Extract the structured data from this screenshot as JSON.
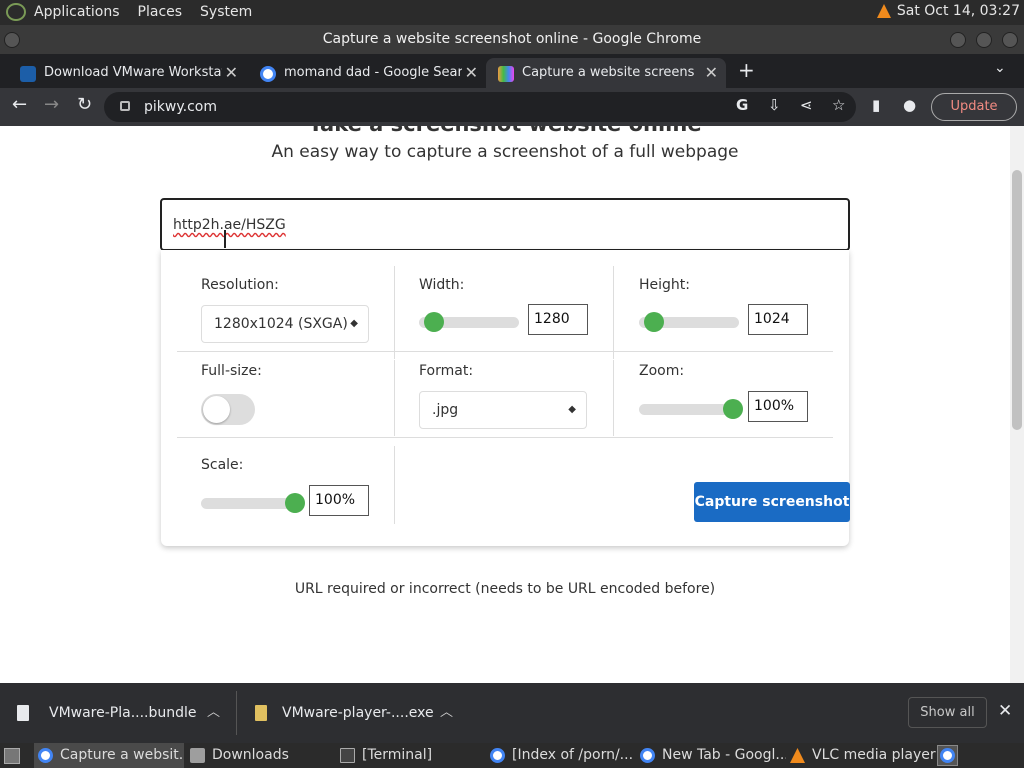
{
  "system_bar": {
    "menus": [
      "Applications",
      "Places",
      "System"
    ],
    "clock": "Sat Oct 14, 03:27"
  },
  "window": {
    "title": "Capture a website screenshot online - Google Chrome"
  },
  "tabs": [
    {
      "label": "Download VMware Workstatio",
      "active": false
    },
    {
      "label": "momand dad - Google Search",
      "active": false
    },
    {
      "label": "Capture a website screenshot",
      "active": true
    }
  ],
  "address_bar": {
    "url": "pikwy.com",
    "update_label": "Update"
  },
  "page": {
    "heading": "Take a screenshot website online",
    "subtitle": "An easy way to capture a screenshot of a full webpage",
    "url_input": "http2h.ae/HSZG",
    "resolution": {
      "label": "Resolution:",
      "value": "1280x1024 (SXGA)"
    },
    "width": {
      "label": "Width:",
      "value": "1280",
      "slider_fraction": 0.1
    },
    "height": {
      "label": "Height:",
      "value": "1024",
      "slider_fraction": 0.1
    },
    "fullsize": {
      "label": "Full-size:",
      "on": false
    },
    "format": {
      "label": "Format:",
      "value": ".jpg"
    },
    "zoom": {
      "label": "Zoom:",
      "value": "100%",
      "slider_fraction": 1.0
    },
    "scale": {
      "label": "Scale:",
      "value": "100%",
      "slider_fraction": 1.0
    },
    "capture_label": "Capture screenshot",
    "error_message": "URL required or incorrect (needs to be URL encoded before)"
  },
  "downloads": {
    "items": [
      "VMware-Pla....bundle",
      "VMware-player-....exe"
    ],
    "show_all": "Show all"
  },
  "taskbar": {
    "items": [
      {
        "label": "Capture a websit...",
        "active": true
      },
      {
        "label": "Downloads",
        "active": false
      },
      {
        "label": "[Terminal]",
        "active": false
      },
      {
        "label": "[Index of /porn/...",
        "active": false
      },
      {
        "label": "New Tab - Googl...",
        "active": false
      },
      {
        "label": "VLC media player",
        "active": false
      }
    ]
  },
  "colors": {
    "accent": "#1a6bc4",
    "slider_knob": "#4caf50",
    "chrome_dark": "#202124"
  }
}
